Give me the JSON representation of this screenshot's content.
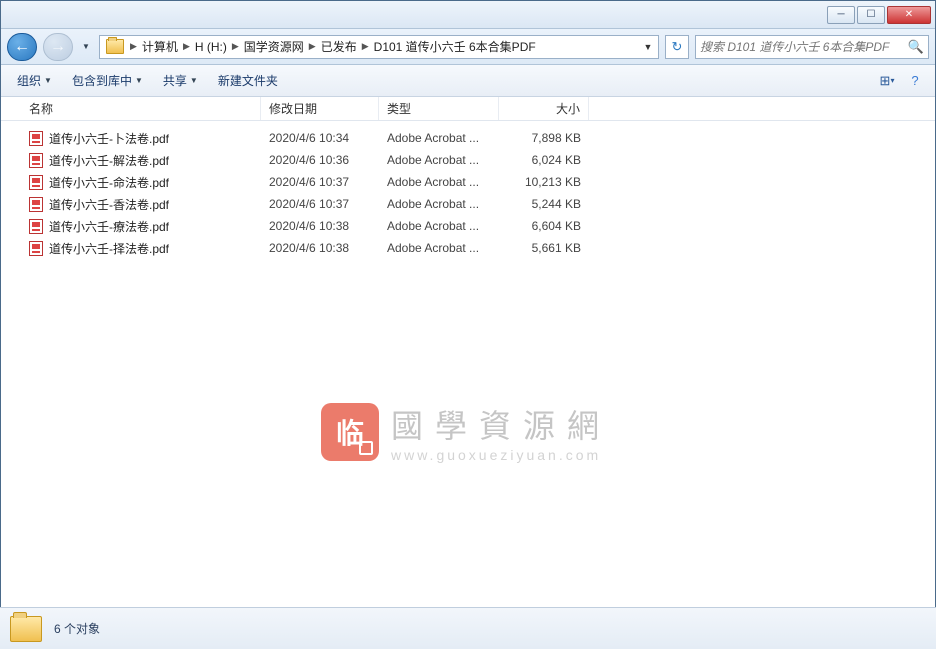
{
  "breadcrumb": {
    "items": [
      "计算机",
      "H (H:)",
      "国学资源网",
      "已发布",
      "D101 道传小六壬 6本合集PDF"
    ]
  },
  "search": {
    "placeholder": "搜索 D101 道传小六壬 6本合集PDF"
  },
  "toolbar": {
    "organize": "组织",
    "include": "包含到库中",
    "share": "共享",
    "newfolder": "新建文件夹"
  },
  "columns": {
    "name": "名称",
    "date": "修改日期",
    "type": "类型",
    "size": "大小"
  },
  "files": [
    {
      "name": "道传小六壬-卜法卷.pdf",
      "date": "2020/4/6 10:34",
      "type": "Adobe Acrobat ...",
      "size": "7,898 KB"
    },
    {
      "name": "道传小六壬-解法卷.pdf",
      "date": "2020/4/6 10:36",
      "type": "Adobe Acrobat ...",
      "size": "6,024 KB"
    },
    {
      "name": "道传小六壬-命法卷.pdf",
      "date": "2020/4/6 10:37",
      "type": "Adobe Acrobat ...",
      "size": "10,213 KB"
    },
    {
      "name": "道传小六壬-香法卷.pdf",
      "date": "2020/4/6 10:37",
      "type": "Adobe Acrobat ...",
      "size": "5,244 KB"
    },
    {
      "name": "道传小六壬-療法卷.pdf",
      "date": "2020/4/6 10:38",
      "type": "Adobe Acrobat ...",
      "size": "6,604 KB"
    },
    {
      "name": "道传小六壬-择法卷.pdf",
      "date": "2020/4/6 10:38",
      "type": "Adobe Acrobat ...",
      "size": "5,661 KB"
    }
  ],
  "status": {
    "text": "6 个对象"
  },
  "watermark": {
    "logo": "临",
    "title": "國學資源網",
    "url": "www.guoxueziyuan.com"
  }
}
